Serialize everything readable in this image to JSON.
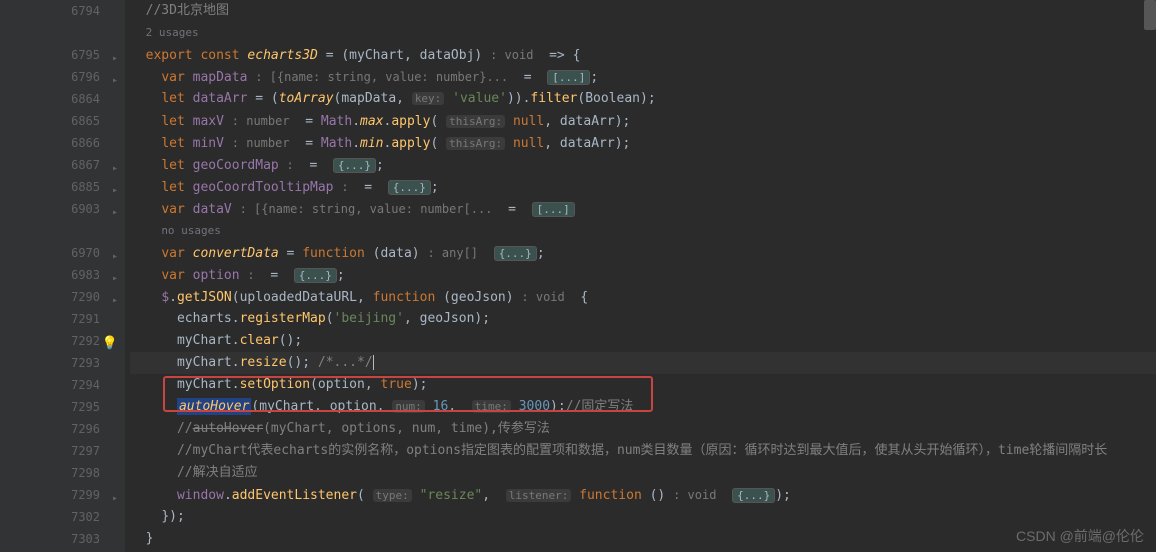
{
  "watermark": "CSDN @前端@伦伦",
  "gutter": [
    {
      "ln": "6794"
    },
    {
      "ln": ""
    },
    {
      "ln": "6795",
      "fold": true
    },
    {
      "ln": "6796",
      "fold": true
    },
    {
      "ln": "6864"
    },
    {
      "ln": "6865"
    },
    {
      "ln": "6866"
    },
    {
      "ln": "6867",
      "fold": true
    },
    {
      "ln": "6885",
      "fold": true
    },
    {
      "ln": "6903",
      "fold": true
    },
    {
      "ln": ""
    },
    {
      "ln": "6970",
      "fold": true
    },
    {
      "ln": "6983",
      "fold": true
    },
    {
      "ln": "7290",
      "fold": true
    },
    {
      "ln": "7291"
    },
    {
      "ln": "7292",
      "bulb": true
    },
    {
      "ln": "7293"
    },
    {
      "ln": "7294"
    },
    {
      "ln": "7295"
    },
    {
      "ln": "7296"
    },
    {
      "ln": "7297"
    },
    {
      "ln": "7298"
    },
    {
      "ln": "7299",
      "fold": true
    },
    {
      "ln": "7302"
    },
    {
      "ln": "7303"
    }
  ],
  "code": {
    "l0_comment": "//3D北京地图",
    "l1_usage": "2 usages",
    "l2": {
      "kw1": "export",
      "kw2": "const",
      "name": "echarts3D",
      "params": "(myChart, dataObj)",
      "type": ": void",
      "arrow": "=>",
      "brace": "{"
    },
    "l3": {
      "kw": "var",
      "name": "mapData",
      "type": ": [{name: string, value: number}...",
      "eq": "=",
      "fold": "[...]",
      "semi": ";"
    },
    "l4": {
      "kw": "let",
      "name": "dataArr",
      "eq": "= (",
      "fn": "toArray",
      "args1": "(mapData,",
      "hint": "key:",
      "str": "'value'",
      "args2": ")).",
      "fn2": "filter",
      "args3": "(Boolean);"
    },
    "l5": {
      "kw": "let",
      "name": "maxV",
      "type": ": number",
      "eq": "=",
      "obj": "Math",
      "dot1": ".",
      "fn1": "max",
      "dot2": ".",
      "fn2": "apply",
      "paren": "(",
      "hint": "thisArg:",
      "null": "null",
      "rest": ", dataArr);"
    },
    "l6": {
      "kw": "let",
      "name": "minV",
      "type": ": number",
      "eq": "=",
      "obj": "Math",
      "dot1": ".",
      "fn1": "min",
      "dot2": ".",
      "fn2": "apply",
      "paren": "(",
      "hint": "thisArg:",
      "null": "null",
      "rest": ", dataArr);"
    },
    "l7": {
      "kw": "let",
      "name": "geoCoordMap",
      "type": ":",
      "eq": "=",
      "fold": "{...}",
      "semi": ";"
    },
    "l8": {
      "kw": "let",
      "name": "geoCoordTooltipMap",
      "type": ":",
      "eq": "=",
      "fold": "{...}",
      "semi": ";"
    },
    "l9": {
      "kw": "var",
      "name": "dataV",
      "type": ": [{name: string, value: number[...",
      "eq": "=",
      "fold": "[...]"
    },
    "l10_usage": "no usages",
    "l11": {
      "kw": "var",
      "name": "convertData",
      "eq": "=",
      "fnkw": "function",
      "params": "(data)",
      "type": ": any[]",
      "fold": "{...}",
      "semi": ";"
    },
    "l12": {
      "kw": "var",
      "name": "option",
      "type": ":",
      "eq": "=",
      "fold": "{...}",
      "semi": ";"
    },
    "l13": {
      "dollar": "$",
      "dot": ".",
      "fn": "getJSON",
      "paren": "(",
      "arg1": "uploadedDataURL,",
      "fnkw": "function",
      "params": "(geoJson)",
      "type": ": void",
      "brace": "{"
    },
    "l14": {
      "obj": "echarts",
      "dot": ".",
      "fn": "registerMap",
      "paren": "(",
      "str": "'beijing'",
      "rest": ", geoJson);"
    },
    "l15": {
      "obj": "myChart",
      "dot": ".",
      "fn": "clear",
      "rest": "();"
    },
    "l16": {
      "obj": "myChart",
      "dot": ".",
      "fn": "resize",
      "rest": "();",
      "comment": "/*...*/"
    },
    "l17": {
      "obj": "myChart",
      "dot": ".",
      "fn": "setOption",
      "paren": "(",
      "args": "option, ",
      "true": "true",
      "rest": ");"
    },
    "l18": {
      "fn": "autoHover",
      "paren": "(",
      "args1": "myChart, option,",
      "hint1": "num:",
      "num1": "16",
      "comma": ",",
      "hint2": "time:",
      "num2": "3000",
      "close": ");",
      "comment": "//固定写法"
    },
    "l19": {
      "comment1": "//",
      "struck": "autoHover",
      "comment2": "(myChart, options, num, time),传参写法"
    },
    "l20_comment": "//myChart代表echarts的实例名称，options指定图表的配置项和数据，num类目数量（原因：循环时达到最大值后，使其从头开始循环），time轮播间隔时长",
    "l21_comment": "//解决自适应",
    "l22": {
      "obj": "window",
      "dot": ".",
      "fn": "addEventListener",
      "paren": "(",
      "hint1": "type:",
      "str": "\"resize\"",
      "comma": ",",
      "hint2": "listener:",
      "fnkw": "function",
      "params": "()",
      "type": ": void",
      "fold": "{...}",
      "close": ");"
    },
    "l23": "});",
    "l24": "}"
  }
}
